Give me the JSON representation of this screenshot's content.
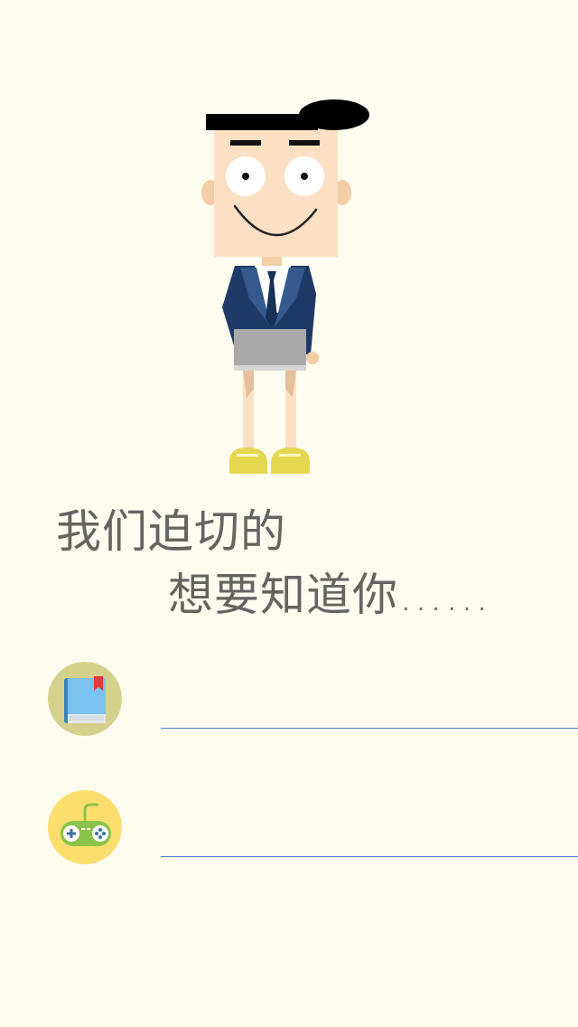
{
  "illustration": {
    "icon": "cartoon-boy-illustration"
  },
  "heading": {
    "line1": "我们迫切的",
    "line2": "想要知道你……"
  },
  "form": {
    "books": {
      "icon": "book-icon",
      "icon_bg": "#D6D08D",
      "value": "",
      "placeholder": ""
    },
    "games": {
      "icon": "gamepad-icon",
      "icon_bg": "#FCDE6F",
      "value": "",
      "placeholder": ""
    },
    "underline_color": "#4A86C8"
  },
  "colors": {
    "background": "#FEFCEF",
    "text": "#666460"
  }
}
